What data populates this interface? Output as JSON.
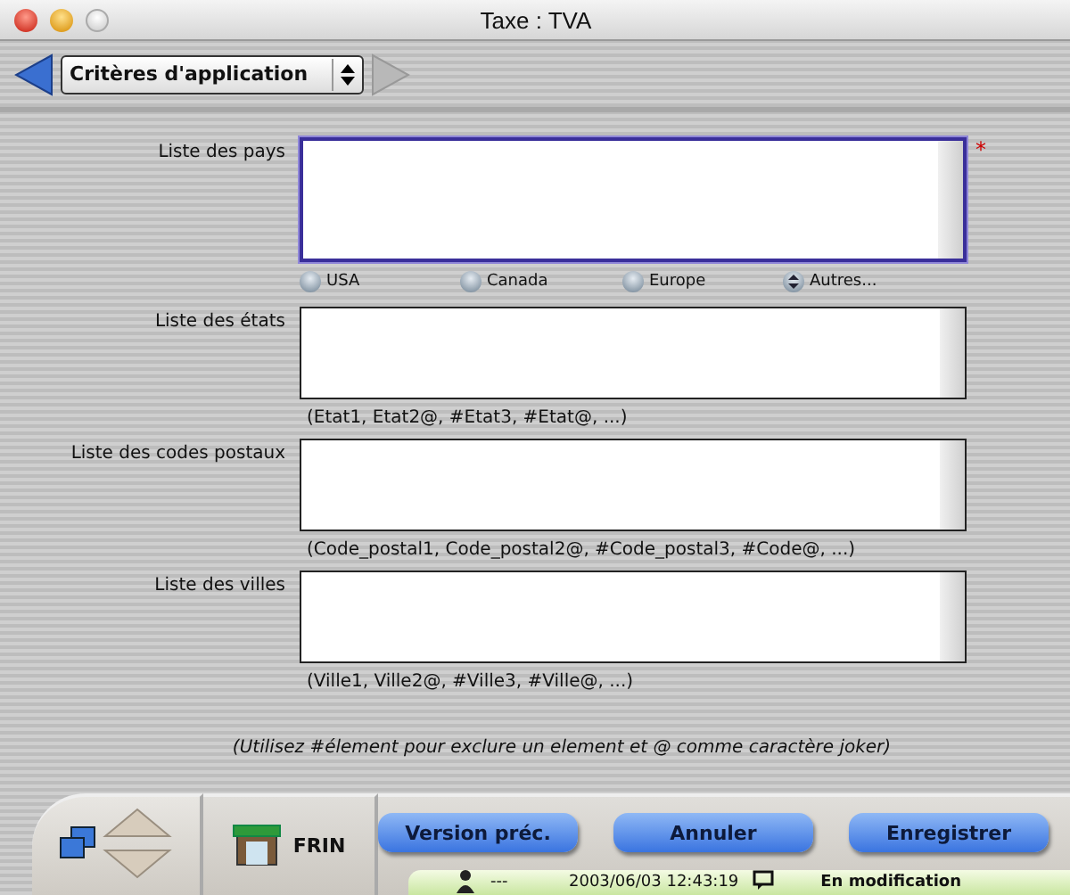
{
  "window": {
    "title": "Taxe : TVA"
  },
  "toolbar": {
    "view_selector": "Critères d'application",
    "back_enabled": true,
    "forward_enabled": false
  },
  "fields": [
    {
      "label": "Liste des pays",
      "focused": true,
      "required_mark": "*",
      "options": [
        {
          "kind": "radio",
          "label": "USA",
          "selected": false
        },
        {
          "kind": "radio",
          "label": "Canada",
          "selected": false
        },
        {
          "kind": "radio",
          "label": "Europe",
          "selected": false
        },
        {
          "kind": "popup",
          "label": "Autres...",
          "selected": false
        }
      ]
    },
    {
      "label": "Liste des états",
      "focused": false,
      "hint": "(Etat1, Etat2@, #Etat3, #Etat@, ...)"
    },
    {
      "label": "Liste des codes postaux",
      "focused": false,
      "hint": "(Code_postal1, Code_postal2@, #Code_postal3, #Code@, ...)"
    },
    {
      "label": "Liste des villes",
      "focused": false,
      "hint": "(Ville1, Ville2@, #Ville3, #Ville@, ...)"
    }
  ],
  "note": "(Utilisez #élement pour exclure un element et @ comme caractère joker)",
  "footer": {
    "user": "FRIN",
    "buttons": [
      "Version préc.",
      "Annuler",
      "Enregistrer"
    ]
  },
  "status_bar": {
    "user": "---",
    "datetime": "2003/06/03  12:43:19",
    "mode": "En modification"
  }
}
